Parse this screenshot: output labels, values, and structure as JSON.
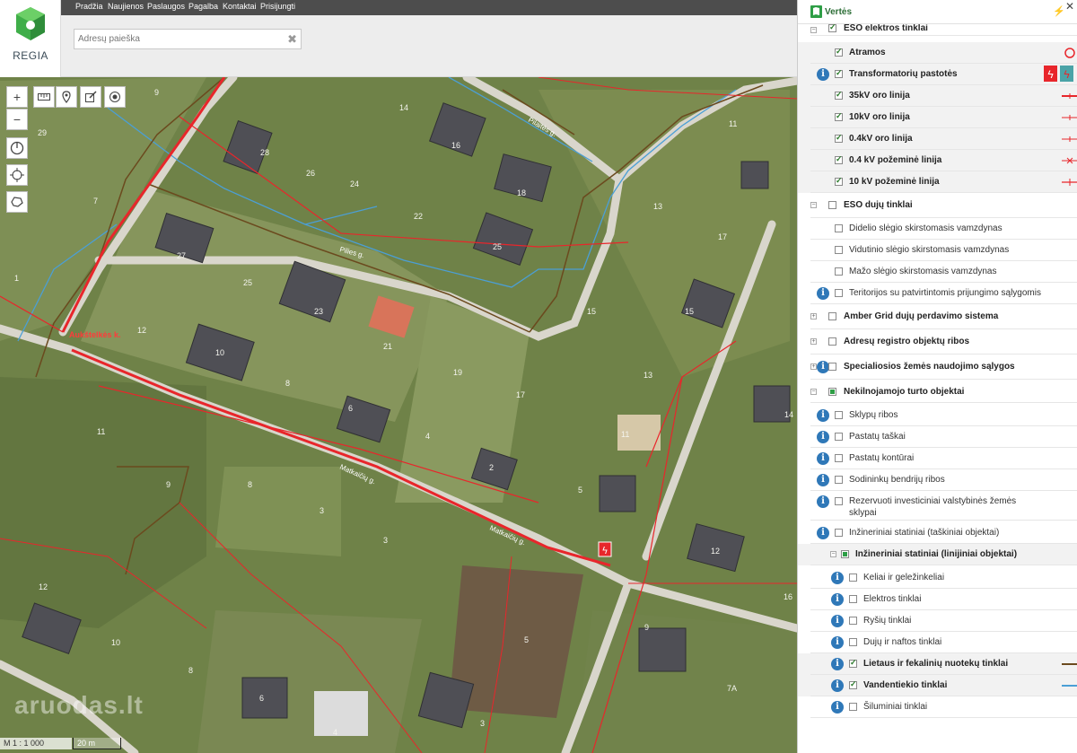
{
  "header": {
    "logo_text": "REGIA",
    "nav": [
      "Pradžia",
      "Naujienos",
      "Paslaugos",
      "Pagalba",
      "Kontaktai",
      "Prisijungti"
    ],
    "search_placeholder": "Adresų paieška"
  },
  "map": {
    "scale_text": "M 1 : 1 000",
    "scale_bar_text": "20 m",
    "watermark": "aruodas.lt",
    "streets": {
      "pilies": "Pilies g.",
      "pilaites": "Pilaitės g.",
      "aukstelkes": "Aukštelkės k.",
      "matkaiciu": "Matkaičių g.",
      "matkaiciu2": "Matkaičių g."
    },
    "lots": [
      "9",
      "14",
      "28",
      "16",
      "11",
      "26",
      "24",
      "18",
      "7",
      "22",
      "29",
      "27",
      "13",
      "25",
      "25",
      "17",
      "1",
      "23",
      "21",
      "15",
      "15",
      "12",
      "10",
      "8",
      "19",
      "13",
      "6",
      "17",
      "4",
      "11",
      "11",
      "14",
      "2",
      "9",
      "3",
      "8",
      "5",
      "3",
      "12",
      "12",
      "10",
      "16",
      "8",
      "6",
      "5",
      "9",
      "3",
      "7A",
      "4"
    ]
  },
  "panel": {
    "title": "Vertės",
    "items": [
      {
        "label": "ESO elektros tinklai",
        "level": 0,
        "bold": true,
        "checked": true
      },
      {
        "label": "Atramos",
        "level": 1,
        "bold": true,
        "checked": true,
        "symbol": "circle-red"
      },
      {
        "label": "Transformatorių pastotės",
        "level": 1,
        "bold": true,
        "checked": true,
        "info": true,
        "symbol": "substation"
      },
      {
        "label": "35kV oro linija",
        "level": 1,
        "bold": true,
        "checked": true,
        "symbol": "line-red"
      },
      {
        "label": "10kV oro linija",
        "level": 1,
        "bold": true,
        "checked": true,
        "symbol": "line-red-thin"
      },
      {
        "label": "0.4kV oro linija",
        "level": 1,
        "bold": true,
        "checked": true,
        "symbol": "line-red-thin"
      },
      {
        "label": "0.4 kV požeminė linija",
        "level": 1,
        "bold": true,
        "checked": true,
        "symbol": "line-red-x"
      },
      {
        "label": "10 kV požeminė linija",
        "level": 1,
        "bold": true,
        "checked": true,
        "symbol": "line-red-tick"
      },
      {
        "label": "ESO dujų tinklai",
        "level": 0,
        "bold": true,
        "checked": false
      },
      {
        "label": "Didelio slėgio skirstomasis vamzdynas",
        "level": 1,
        "checked": false
      },
      {
        "label": "Vidutinio slėgio skirstomasis vamzdynas",
        "level": 1,
        "checked": false
      },
      {
        "label": "Mažo slėgio skirstomasis vamzdynas",
        "level": 1,
        "checked": false
      },
      {
        "label": "Teritorijos su patvirtintomis prijungimo sąlygomis",
        "level": 1,
        "checked": false,
        "info": true
      },
      {
        "label": "Amber Grid dujų perdavimo sistema",
        "level": 0,
        "bold": true,
        "checked": false
      },
      {
        "label": "Adresų registro objektų ribos",
        "level": 0,
        "bold": true,
        "checked": false
      },
      {
        "label": "Specialiosios žemės naudojimo sąlygos",
        "level": 0,
        "bold": true,
        "checked": false,
        "info": true
      },
      {
        "label": "Nekilnojamojo turto objektai",
        "level": 0,
        "bold": true,
        "partial": true
      },
      {
        "label": "Sklypų ribos",
        "level": 1,
        "checked": false,
        "info": true
      },
      {
        "label": "Pastatų taškai",
        "level": 1,
        "checked": false,
        "info": true
      },
      {
        "label": "Pastatų kontūrai",
        "level": 1,
        "checked": false,
        "info": true
      },
      {
        "label": "Sodininkų bendrijų ribos",
        "level": 1,
        "checked": false,
        "info": true
      },
      {
        "label": "Rezervuoti investiciniai valstybinės žemės",
        "label2": "sklypai",
        "level": 1,
        "checked": false,
        "info": true
      },
      {
        "label": "Inžineriniai statiniai (taškiniai objektai)",
        "level": 1,
        "checked": false,
        "info": true
      },
      {
        "label": "Inžineriniai statiniai (linijiniai objektai)",
        "level": 1,
        "bold": true,
        "partial": true
      },
      {
        "label": "Keliai ir geležinkeliai",
        "level": 2,
        "checked": false,
        "info": true
      },
      {
        "label": "Elektros tinklai",
        "level": 2,
        "checked": false,
        "info": true
      },
      {
        "label": "Ryšių tinklai",
        "level": 2,
        "checked": false,
        "info": true
      },
      {
        "label": "Dujų ir naftos tinklai",
        "level": 2,
        "checked": false,
        "info": true
      },
      {
        "label": "Lietaus ir fekalinių nuotekų tinklai",
        "level": 2,
        "bold": true,
        "checked": true,
        "info": true,
        "symbol": "line-brown"
      },
      {
        "label": "Vandentiekio tinklai",
        "level": 2,
        "bold": true,
        "checked": true,
        "info": true,
        "symbol": "line-blue"
      },
      {
        "label": "Šiluminiai tinklai",
        "level": 2,
        "checked": false,
        "info": true
      }
    ]
  },
  "colors": {
    "accent_green": "#2b6d35",
    "info_blue": "#2f78b8",
    "power_red": "#e8262b",
    "water_blue": "#4b9fd6",
    "sewer_brown": "#6b4a1e"
  }
}
